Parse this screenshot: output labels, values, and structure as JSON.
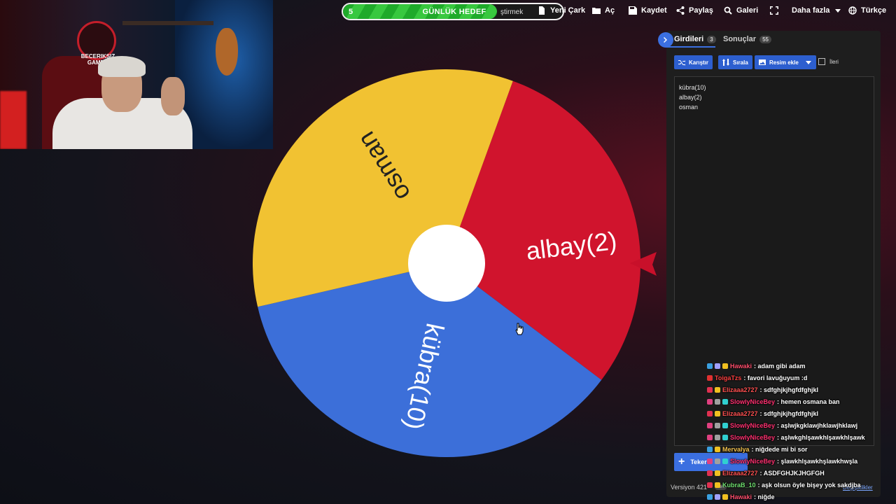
{
  "colors": {
    "yellow": "#f1c232",
    "red": "#d0142d",
    "blue": "#3c6fd9",
    "accent": "#3b6fe0"
  },
  "toolbar": {
    "daily_goal": {
      "count": "5",
      "label": "GÜNLÜK HEDEF",
      "hidden_text": "ştirmek",
      "progress": 0.7
    },
    "new_wheel": "Yeni Çark",
    "open": "Aç",
    "save": "Kaydet",
    "share": "Paylaş",
    "gallery": "Galeri",
    "more": "Daha fazla",
    "language": "Türkçe"
  },
  "webcam": {
    "logo_text": "BECERIKSIZ GAMEO"
  },
  "wheel": {
    "segments": [
      {
        "label": "albay(2)",
        "color": "#d0142d"
      },
      {
        "label": "kübra(10)",
        "color": "#3c6fd9"
      },
      {
        "label": "osman",
        "color": "#f1c232"
      }
    ]
  },
  "panel": {
    "tabs": [
      {
        "label": "Girdileri",
        "count": "3"
      },
      {
        "label": "Sonuçlar",
        "count": "55"
      }
    ],
    "buttons": {
      "shuffle": "Karıştır",
      "sort": "Sırala",
      "add_image": "Resim ekle"
    },
    "advanced_label": "İleri",
    "entries": [
      "kübra(10)",
      "albay(2)",
      "osman"
    ],
    "add_wheel": "Teker",
    "version": "Versiyon 421",
    "version_badge": "Yeni",
    "changes_link": "Değişiklikler"
  },
  "chat": [
    {
      "user": "Hawaki",
      "user_color": "#ff4f6d",
      "text": ": adam gibi adam",
      "badges": [
        "#3aa0e0",
        "#a0a0ff",
        "#f0c020"
      ]
    },
    {
      "user": "ToigaTzs",
      "user_color": "#ff4040",
      "text": ": favori lavuğuyum :d",
      "badges": [
        "#e03030"
      ]
    },
    {
      "user": "Elizaaa2727",
      "user_color": "#ff5050",
      "text": ": sdfghjkjhgfdfghjkl",
      "badges": [
        "#e03050",
        "#f0c020"
      ]
    },
    {
      "user": "SlowlyNiceBey",
      "user_color": "#ff3070",
      "text": ": hemen osmana ban",
      "badges": [
        "#e04080",
        "#a0a0a0",
        "#30d0d0"
      ]
    },
    {
      "user": "Elizaaa2727",
      "user_color": "#ff5050",
      "text": ": sdfghjkjhgfdfghjkl",
      "badges": [
        "#e03050",
        "#f0c020"
      ]
    },
    {
      "user": "SlowlyNiceBey",
      "user_color": "#ff3070",
      "text": ": aşlwjkgklawjhklawjhklawj",
      "badges": [
        "#e04080",
        "#a0a0a0",
        "#30d0d0"
      ]
    },
    {
      "user": "SlowlyNiceBey",
      "user_color": "#ff3070",
      "text": ": aşlwkghlşawkhlşawkhlşawk",
      "badges": [
        "#e04080",
        "#a0a0a0",
        "#30d0d0"
      ]
    },
    {
      "user": "Mervalya",
      "user_color": "#f0c050",
      "text": ": niğdede mi bi sor",
      "badges": [
        "#3aa0e0",
        "#f0c020"
      ]
    },
    {
      "user": "SlowlyNiceBey",
      "user_color": "#ff3070",
      "text": ": şlawkhlşawkhşlawkhwşla",
      "badges": [
        "#e04080",
        "#a0a0a0",
        "#30d0d0"
      ]
    },
    {
      "user": "Elizaaa2727",
      "user_color": "#ff5050",
      "text": ": ASDFGHJKJHGFGH",
      "badges": [
        "#e03050",
        "#f0c020"
      ]
    },
    {
      "user": "KubraB_10",
      "user_color": "#70e070",
      "text": ": aşk olsun öyle bişey yok sakdjba",
      "badges": [
        "#e03050",
        "#f0c020"
      ]
    },
    {
      "user": "Hawaki",
      "user_color": "#ff4f6d",
      "text": ": niğde",
      "badges": [
        "#3aa0e0",
        "#a0a0ff",
        "#f0c020"
      ]
    }
  ]
}
